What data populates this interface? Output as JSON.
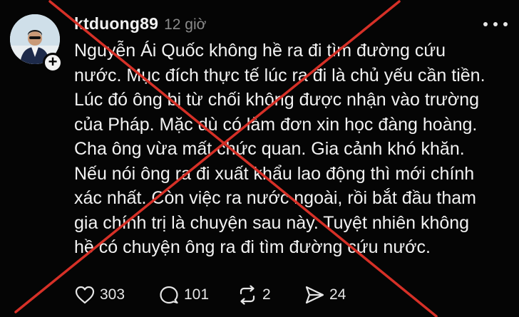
{
  "post": {
    "username": "ktduong89",
    "timestamp": "12 giờ",
    "follow_symbol": "+",
    "body_lines": [
      "Nguyễn Ái Quốc không hề ra đi tìm đường cứu",
      "nước. Mục đích thực tế lúc ra đi là chủ yếu cần tiền.",
      "Lúc đó ông bị từ chối không được nhận vào trường",
      "của Pháp. Mặc dù có làm đơn xin học đàng hoàng.",
      "Cha ông vừa mất chức quan. Gia cảnh khó khăn.",
      "Nếu nói ông ra đi xuất khẩu lao động thì mới chính",
      "xác nhất. Còn việc ra nước ngoài, rồi bắt đầu tham",
      "gia chính trị là chuyện sau này. Tuyệt nhiên không",
      "hề có chuyện ông ra đi tìm đường cứu nước."
    ]
  },
  "actions": {
    "likes": "303",
    "comments": "101",
    "reposts": "2",
    "shares": "24"
  },
  "icons": {
    "like": "heart-icon",
    "comment": "speech-bubble-icon",
    "repost": "repost-arrows-icon",
    "share": "paper-plane-icon",
    "more": "more-dots-icon"
  },
  "colors": {
    "background": "#050505",
    "text": "#f2f2f2",
    "muted": "#8a8a8a",
    "cross_overlay": "#d63027"
  }
}
